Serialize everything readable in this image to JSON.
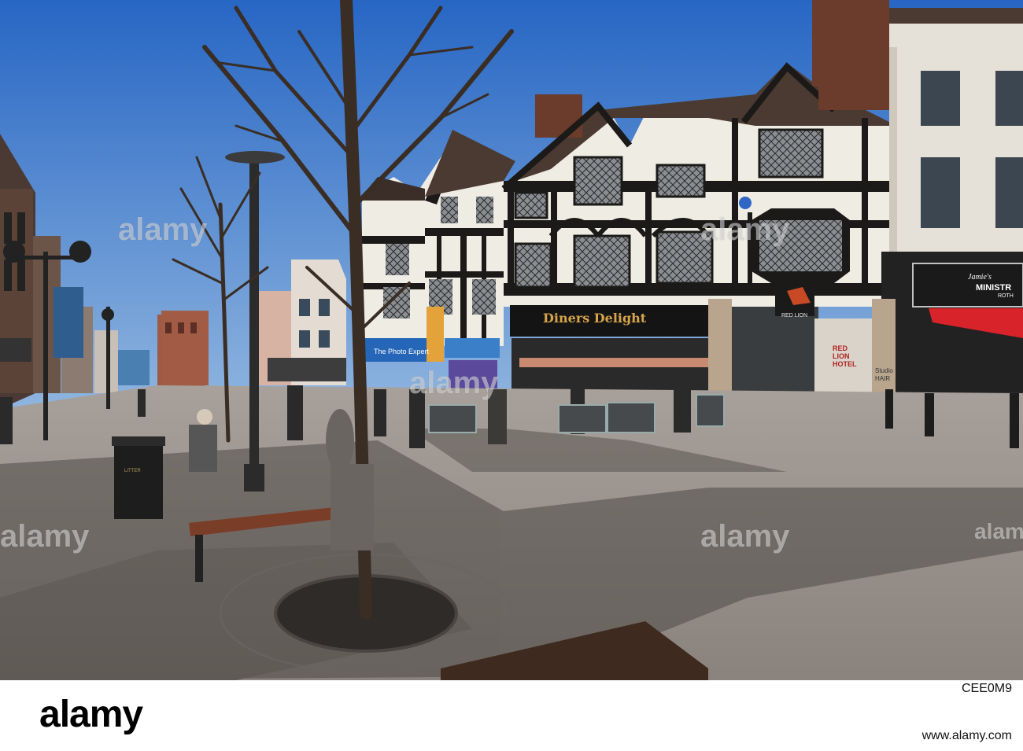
{
  "watermark": {
    "text": "alamy"
  },
  "signs": {
    "diners": "Diners Delight",
    "photo_expert": "The Photo Expert",
    "red_lion": "RED LION",
    "red_lion_hotel": "RED LION HOTEL",
    "studio_hair": "Studio HAIR",
    "ministry_brand": "Jamie's",
    "ministry": "MINISTR",
    "ministry_sub": "ROTH",
    "litter": "LITTER"
  },
  "footer": {
    "logo": "alamy",
    "image_id": "CEE0M9",
    "url": "www.alamy.com"
  },
  "colors": {
    "sky": "#2f6fc7",
    "pavement": "#9d9590",
    "timber_dark": "#1b1a18",
    "render_white": "#efece4"
  }
}
